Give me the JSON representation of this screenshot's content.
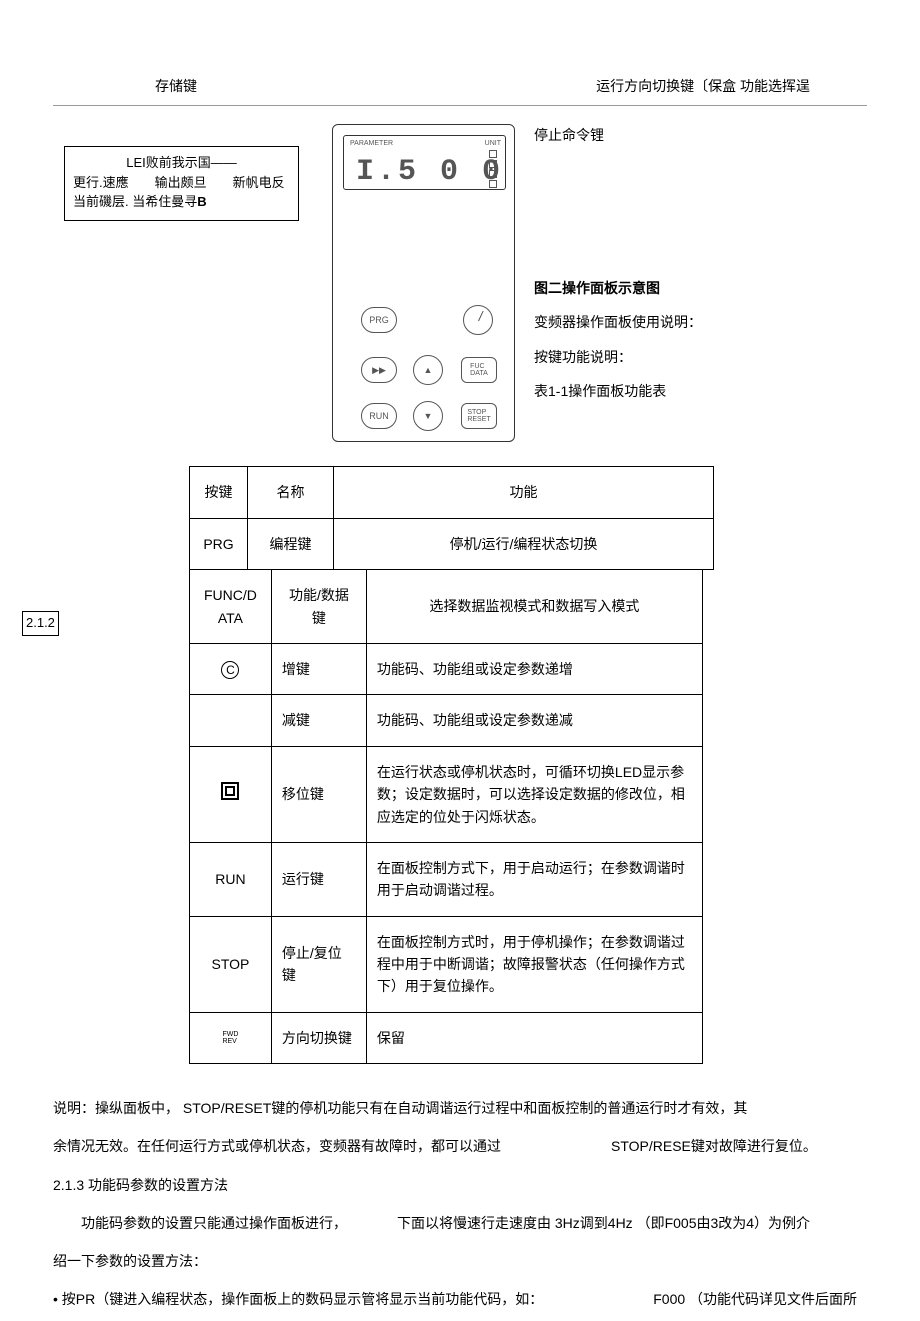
{
  "header": {
    "left": "存储键",
    "right": "运行方向切换键〔保盒 功能选挥逞"
  },
  "ledBox": {
    "row1": "LEI败前我示国——",
    "row2": "更行.速應　　输出颇旦　　新帆电反",
    "row3prefix": "当前磯层. 当希住曼寻",
    "row3bold": "B"
  },
  "panel": {
    "paramLabel": "PARAMETER",
    "unitLabel": "UNIT",
    "display": "I.5 0 0",
    "btnPRG": "PRG",
    "btnFUC": "FUC\nDATA",
    "btnRUN": "RUN",
    "btnSTOP": "STOP\nRESET",
    "btnShift": "▶▶",
    "btnUp": "▲",
    "btnDown": "▼"
  },
  "rightNotes": {
    "n0": "停止命令锂",
    "n1": "图二操作面板示意图",
    "n2": "变频器操作面板使用说明：",
    "n3": "按键功能说明：",
    "n4": "表1-1操作面板功能表"
  },
  "table1": {
    "h1": "按键",
    "h2": "名称",
    "h3": "功能",
    "r1c1": "PRG",
    "r1c2": "编程键",
    "r1c3": "停机/运行/编程状态切换"
  },
  "sideLabel": "2.1.2",
  "table2": {
    "r0c1": "FUNC/D ATA",
    "r0c2": "功能/数据 键",
    "r0c3": "选择数据监视模式和数据写入模式",
    "r1c1": "C",
    "r1c2": "增键",
    "r1c3": "功能码、功能组或设定参数递增",
    "r2c1": "",
    "r2c2": "减键",
    "r2c3": "功能码、功能组或设定参数递减",
    "r3c2": "移位键",
    "r3c3a": "在运行状态或停机状态时，可循环切换",
    "r3c3b": "LED显示参",
    "r3c3c": "数；设定数据时，可以选择设定数据的修改位，相应选定的位处于闪烁状态。",
    "r4c1": "RUN",
    "r4c2": "运行键",
    "r4c3": "在面板控制方式下，用于启动运行；在参数调谐时用于启动调谐过程。",
    "r5c1": "STOP",
    "r5c2": "停止/复位 键",
    "r5c3": "在面板控制方式时，用于停机操作；在参数调谐过程中用于中断调谐；故障报警状态（任何操作方式下）用于复位操作。",
    "r6c1a": "FWD",
    "r6c1b": "REV",
    "r6c2": "方向切换键",
    "r6c3": "保留"
  },
  "para": {
    "p1a": "说明：操纵面板中，",
    "p1b": "STOP/RESET键的停机功能只有在自动调谐运行过程中和面板控制的普通运行时才有效，其",
    "p2a": "余情况无效。在任何运行方式或停机状态，变频器有故障时，都可以通过",
    "p2b": "STOP/RESE键对故障进行复位。",
    "p3": "2.1.3 功能码参数的设置方法",
    "p4a": "功能码参数的设置只能通过操作面板进行，",
    "p4b": "下面以将慢速行走速度由",
    "p4c": "3Hz调到4Hz （即F005由3改为4）为例介",
    "p5": "绍一下参数的设置方法：",
    "p6a": "• 按PR（键进入编程状态，操作面板上的数码显示管将显示当前功能代码，如：",
    "p6b": "F000 （功能代码详见文件后面所"
  }
}
